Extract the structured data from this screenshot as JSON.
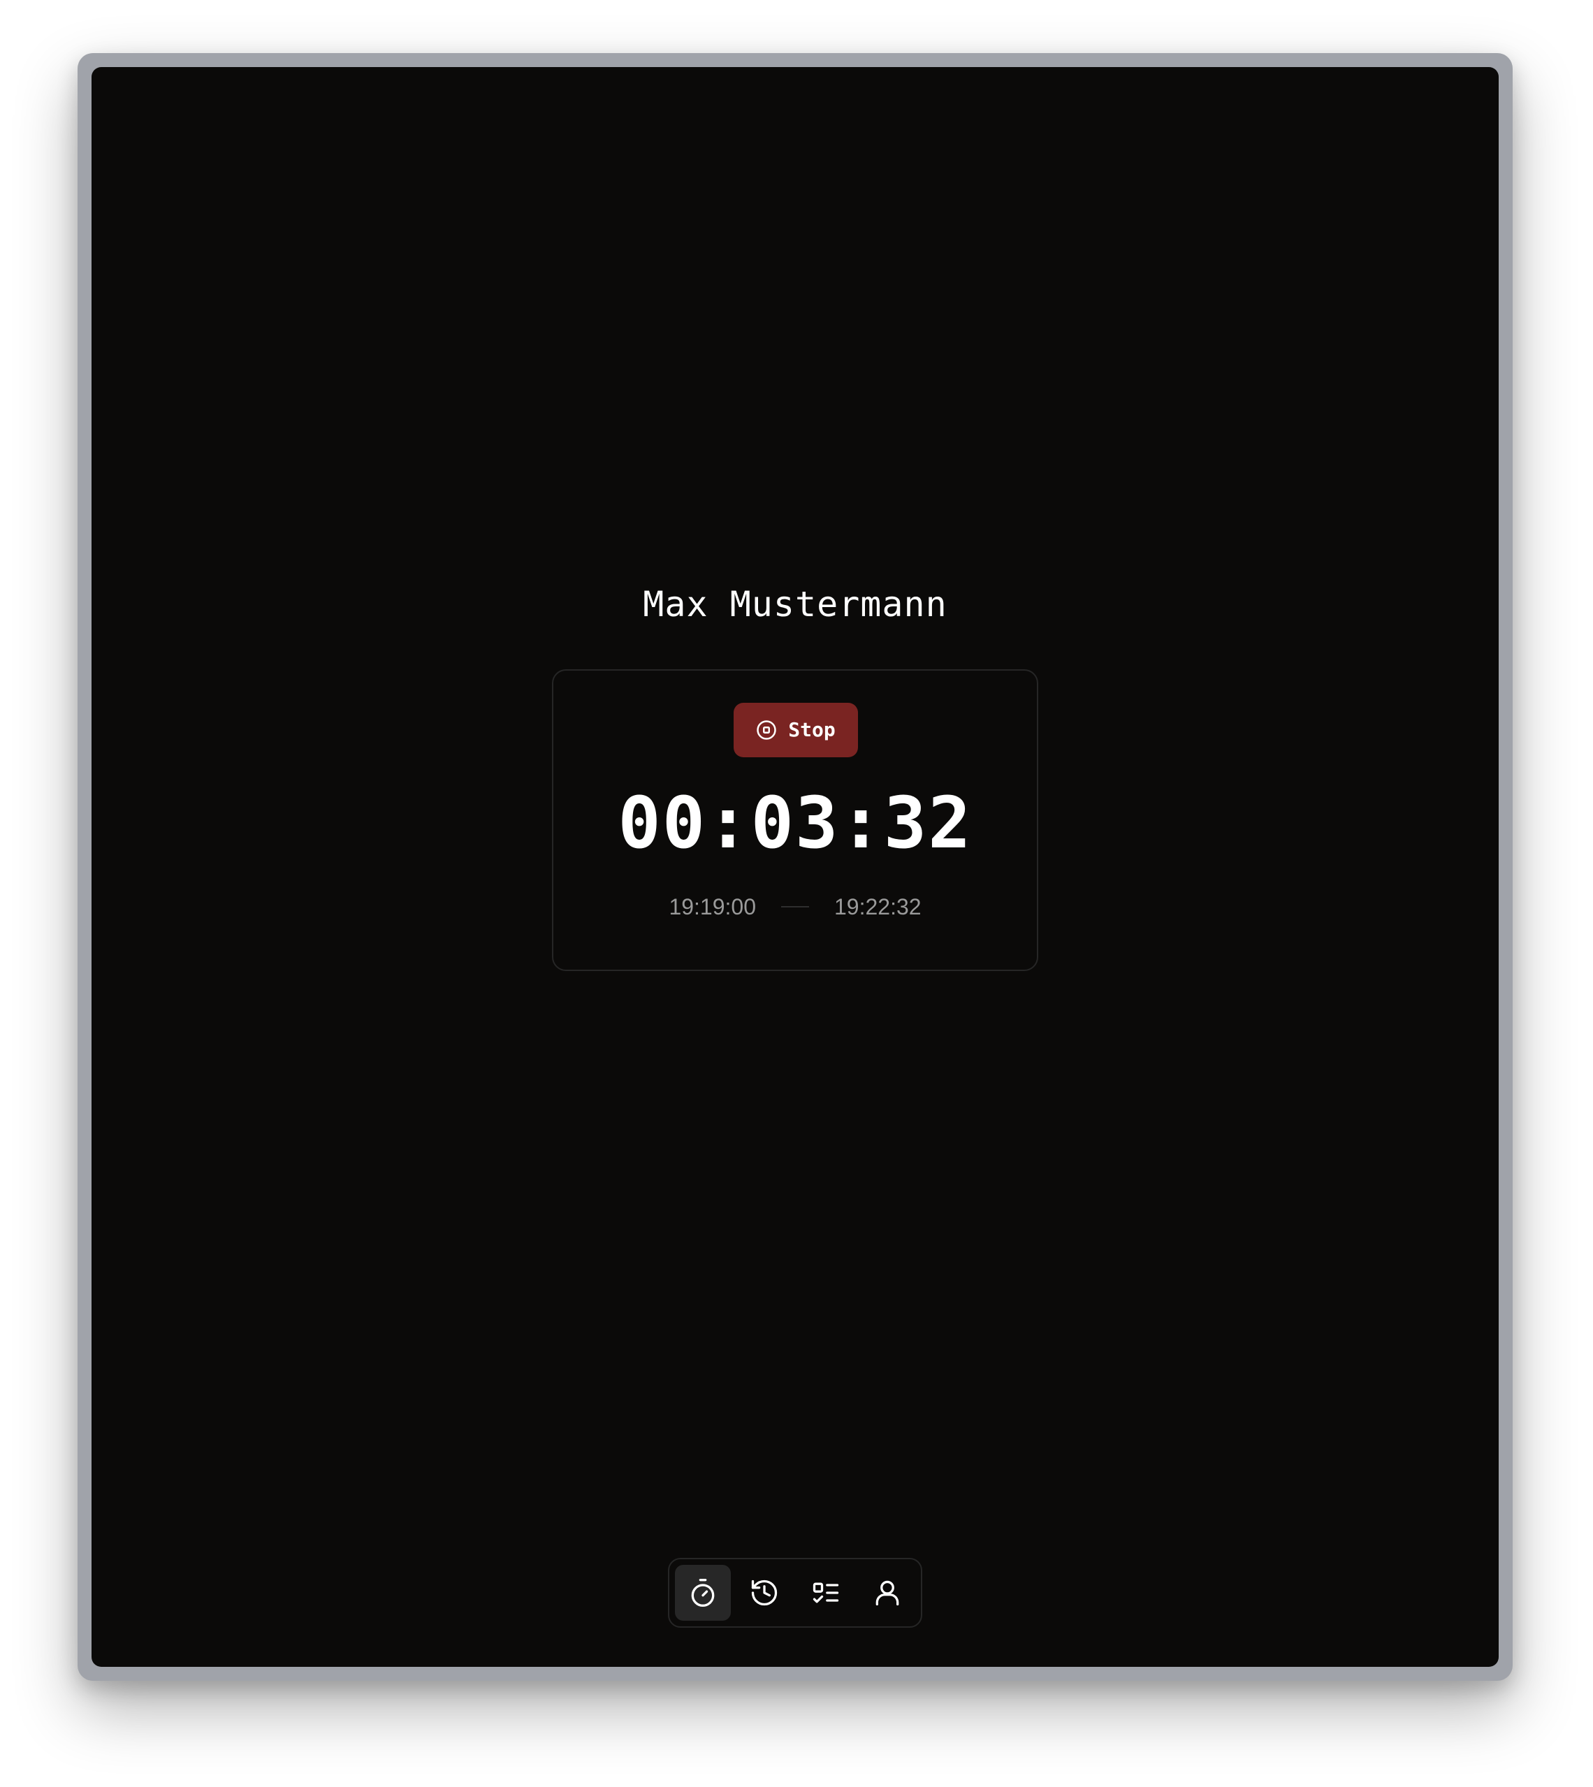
{
  "user": {
    "name": "Max Mustermann"
  },
  "timer": {
    "stop_label": "Stop",
    "elapsed": "00:03:32",
    "start_time": "19:19:00",
    "end_time": "19:22:32",
    "stop_color": "#7a2422"
  },
  "nav": {
    "items": [
      {
        "icon": "stopwatch-icon",
        "active": true
      },
      {
        "icon": "history-icon",
        "active": false
      },
      {
        "icon": "checklist-icon",
        "active": false
      },
      {
        "icon": "user-icon",
        "active": false
      }
    ]
  }
}
